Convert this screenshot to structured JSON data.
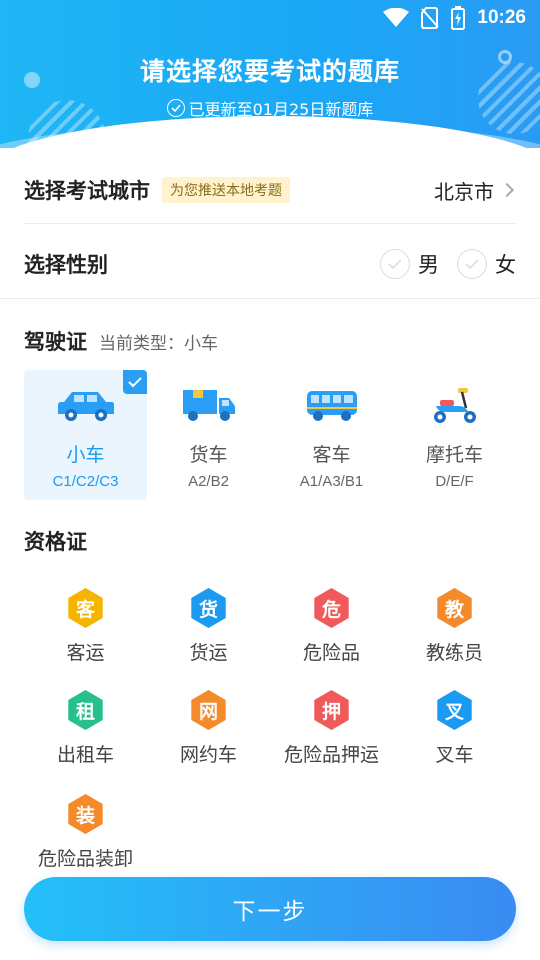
{
  "status_bar": {
    "time": "10:26"
  },
  "header": {
    "title": "请选择您要考试的题库",
    "subtitle": "已更新至01月25日新题库"
  },
  "city_row": {
    "label": "选择考试城市",
    "tag": "为您推送本地考题",
    "value": "北京市"
  },
  "gender_row": {
    "label": "选择性别",
    "options": [
      "男",
      "女"
    ]
  },
  "license": {
    "title": "驾驶证",
    "current_label": "当前类型：小车",
    "items": [
      {
        "name": "小车",
        "code": "C1/C2/C3",
        "selected": true,
        "icon": "car-icon"
      },
      {
        "name": "货车",
        "code": "A2/B2",
        "selected": false,
        "icon": "truck-icon"
      },
      {
        "name": "客车",
        "code": "A1/A3/B1",
        "selected": false,
        "icon": "bus-icon"
      },
      {
        "name": "摩托车",
        "code": "D/E/F",
        "selected": false,
        "icon": "motorcycle-icon"
      }
    ]
  },
  "qualification": {
    "title": "资格证",
    "items": [
      {
        "badge": "客",
        "label": "客运",
        "color": "#f5b400"
      },
      {
        "badge": "货",
        "label": "货运",
        "color": "#1a9af0"
      },
      {
        "badge": "危",
        "label": "危险品",
        "color": "#f05a5a"
      },
      {
        "badge": "教",
        "label": "教练员",
        "color": "#f58a2a"
      },
      {
        "badge": "租",
        "label": "出租车",
        "color": "#27c08a"
      },
      {
        "badge": "网",
        "label": "网约车",
        "color": "#f58a2a"
      },
      {
        "badge": "押",
        "label": "危险品押运",
        "color": "#f05a5a"
      },
      {
        "badge": "叉",
        "label": "叉车",
        "color": "#1a9af0"
      },
      {
        "badge": "装",
        "label": "危险品装卸",
        "color": "#f58a2a"
      }
    ]
  },
  "next_button": {
    "label": "下一步"
  },
  "colors": {
    "primary": "#1a9af0",
    "header_bg": "#1fb6f5",
    "tag_bg": "#fff2cc"
  }
}
